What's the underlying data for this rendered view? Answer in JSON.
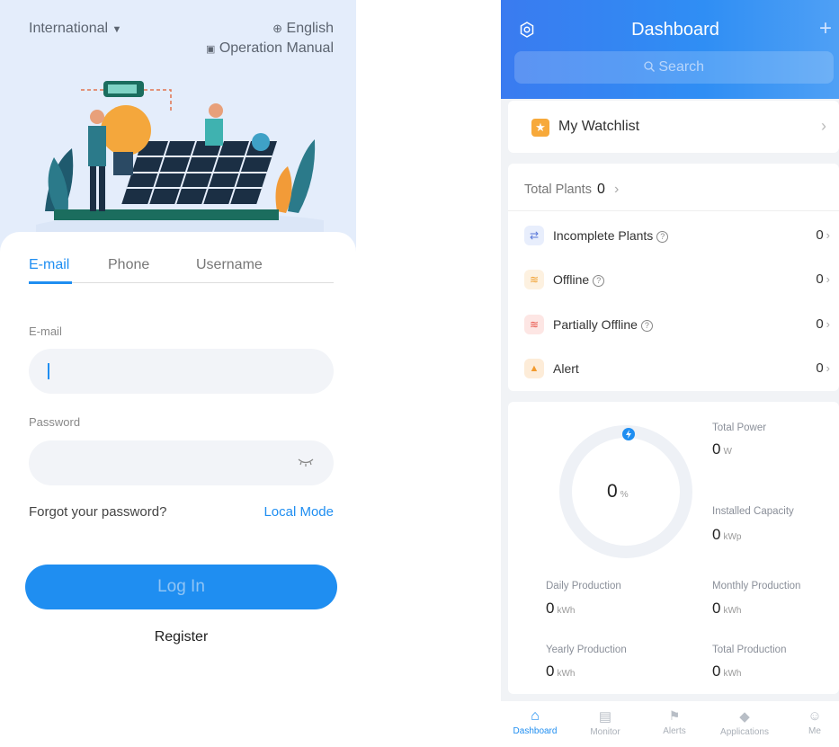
{
  "login": {
    "region": "International",
    "language": "English",
    "manual": "Operation Manual",
    "tabs": [
      "E-mail",
      "Phone",
      "Username"
    ],
    "email_label": "E-mail",
    "email_value": "",
    "password_label": "Password",
    "password_value": "",
    "forgot": "Forgot your password?",
    "local_mode": "Local Mode",
    "login_button": "Log In",
    "register": "Register",
    "accent": "#1f8ef1"
  },
  "dashboard": {
    "title": "Dashboard",
    "search_placeholder": "Search",
    "add_symbol": "+",
    "watchlist": "My Watchlist",
    "total_plants_label": "Total Plants",
    "total_plants_value": "0",
    "rows": [
      {
        "label": "Incomplete Plants",
        "value": "0",
        "help": true,
        "icon": "link-icon"
      },
      {
        "label": "Offline",
        "value": "0",
        "help": true,
        "icon": "wifi-icon"
      },
      {
        "label": "Partially Offline",
        "value": "0",
        "help": true,
        "icon": "wifi-warning-icon"
      },
      {
        "label": "Alert",
        "value": "0",
        "help": false,
        "icon": "alarm-icon"
      }
    ],
    "gauge_value": "0",
    "gauge_unit": "%",
    "total_power": {
      "label": "Total Power",
      "value": "0",
      "unit": "W"
    },
    "installed_capacity": {
      "label": "Installed Capacity",
      "value": "0",
      "unit": "kWp"
    },
    "daily": {
      "label": "Daily Production",
      "value": "0",
      "unit": "kWh"
    },
    "monthly": {
      "label": "Monthly Production",
      "value": "0",
      "unit": "kWh"
    },
    "yearly": {
      "label": "Yearly Production",
      "value": "0",
      "unit": "kWh"
    },
    "total": {
      "label": "Total Production",
      "value": "0",
      "unit": "kWh"
    },
    "nav": [
      "Dashboard",
      "Monitor",
      "Alerts",
      "Applications",
      "Me"
    ]
  }
}
